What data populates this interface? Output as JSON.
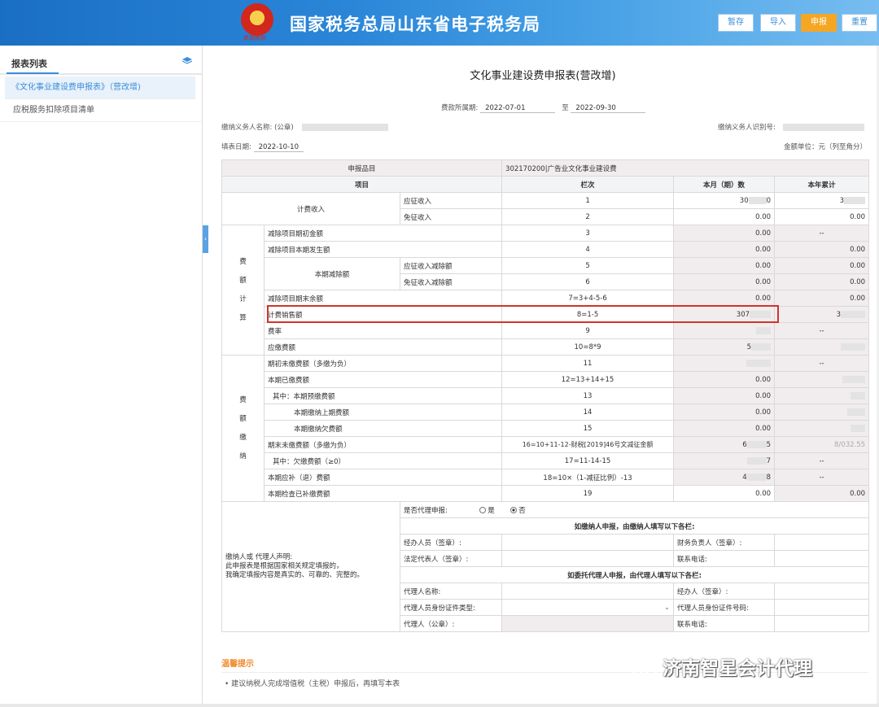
{
  "header": {
    "emblem_text": "青岛税务",
    "site_title": "国家税务总局山东省电子税务局",
    "buttons": [
      "暂存",
      "导入",
      "申报",
      "重置"
    ]
  },
  "sidebar": {
    "title": "报表列表",
    "items": [
      "《文化事业建设费申报表》（营改增)",
      "应税服务扣除项目清单"
    ]
  },
  "form": {
    "title": "文化事业建设费申报表(营改增)",
    "period_label": "费款所属期:",
    "period_start": "2022-07-01",
    "period_to": "至",
    "period_end": "2022-09-30",
    "payer_name_label": "缴纳义务人名称:",
    "payer_name_suffix": "(公章)",
    "payer_id_label": "缴纳义务人识别号:",
    "fill_date_label": "填表日期:",
    "fill_date": "2022-10-10",
    "unit": "金额单位：元（列至角分）"
  },
  "table": {
    "item_label": "申报品目",
    "item_value": "302170200|广告业文化事业建设费",
    "col_item": "项目",
    "col_line": "栏次",
    "col_month": "本月（期）数",
    "col_year": "本年累计",
    "rev_group": "计费收入",
    "rev_taxable": "应征收入",
    "rev_exempt": "免征收入",
    "calc_group": "费额计算",
    "calc_group_chars": [
      "费",
      "额",
      "计",
      "算"
    ],
    "ded_open": "减除项目期初金额",
    "ded_current": "减除项目本期发生额",
    "ded_this": "本期减除额",
    "ded_taxable": "应征收入减除额",
    "ded_exempt": "免征收入减除额",
    "ded_end": "减除项目期末余额",
    "sales": "计费销售额",
    "rate": "费率",
    "payable": "应缴费额",
    "pay_group_chars": [
      "费",
      "额",
      "缴",
      "纳"
    ],
    "pay_open_unpaid": "期初未缴费额（多缴为负）",
    "pay_paid": "本期已缴费额",
    "pay_pre": "其中：本期预缴费额",
    "pay_prev": "本期缴纳上期费额",
    "pay_arrears": "本期缴纳欠费额",
    "pay_end_unpaid": "期末未缴费额（多缴为负）",
    "pay_end_arrears": "其中：欠缴费额（≥0）",
    "pay_due": "本期应补（退）费额",
    "pay_inspect": "本期检查已补缴费额",
    "lines": [
      "1",
      "2",
      "3",
      "4",
      "5",
      "6",
      "7=3+4-5-6",
      "8=1-5",
      "9",
      "10=8*9",
      "11",
      "12=13+14+15",
      "13",
      "14",
      "15",
      "16=10+11-12-财税[2019]46号文减征金额",
      "17=11-14-15",
      "18=10×（1-减征比例）-13",
      "19"
    ],
    "zero": "0.00",
    "dash": "--",
    "partial_month": [
      "30",
      "0"
    ],
    "partial_year": "3",
    "partial_sales_month": "307",
    "partial_payable": "5",
    "partial_end_unpaid": "6",
    "partial_end_unpaid_tail": "5",
    "partial_arrears_tail": "7",
    "partial_due": "4",
    "partial_due_tail": "8",
    "partial_year_end": "8/032.55"
  },
  "declaration": {
    "agent_q": "是否代理申报:",
    "yes": "是",
    "no": "否",
    "payer_note": "如缴纳人申报，由缴纳人填写以下各栏:",
    "handler": "经办人员（签章）:",
    "finance": "财务负责人（签章）:",
    "legal": "法定代表人（签章）:",
    "phone": "联系电话:",
    "agent_note": "如委托代理人申报，由代理人填写以下各栏:",
    "agent_name": "代理人名称:",
    "agent_handler": "经办人（签章）:",
    "agent_id_type": "代理人员身份证件类型:",
    "agent_id_no": "代理人员身份证件号码:",
    "agent_seal": "代理人（公章）:",
    "agent_phone": "联系电话:",
    "statement": "缴纳人或 代理人声明:\n此申报表是根据国家相关规定填报的，\n我确定填报内容是真实的、可靠的、完整的。"
  },
  "tips": {
    "title": "温馨提示",
    "item": "• 建议纳税人完成增值税（主税）申报后，再填写本表"
  },
  "watermark": "济南智星会计代理"
}
